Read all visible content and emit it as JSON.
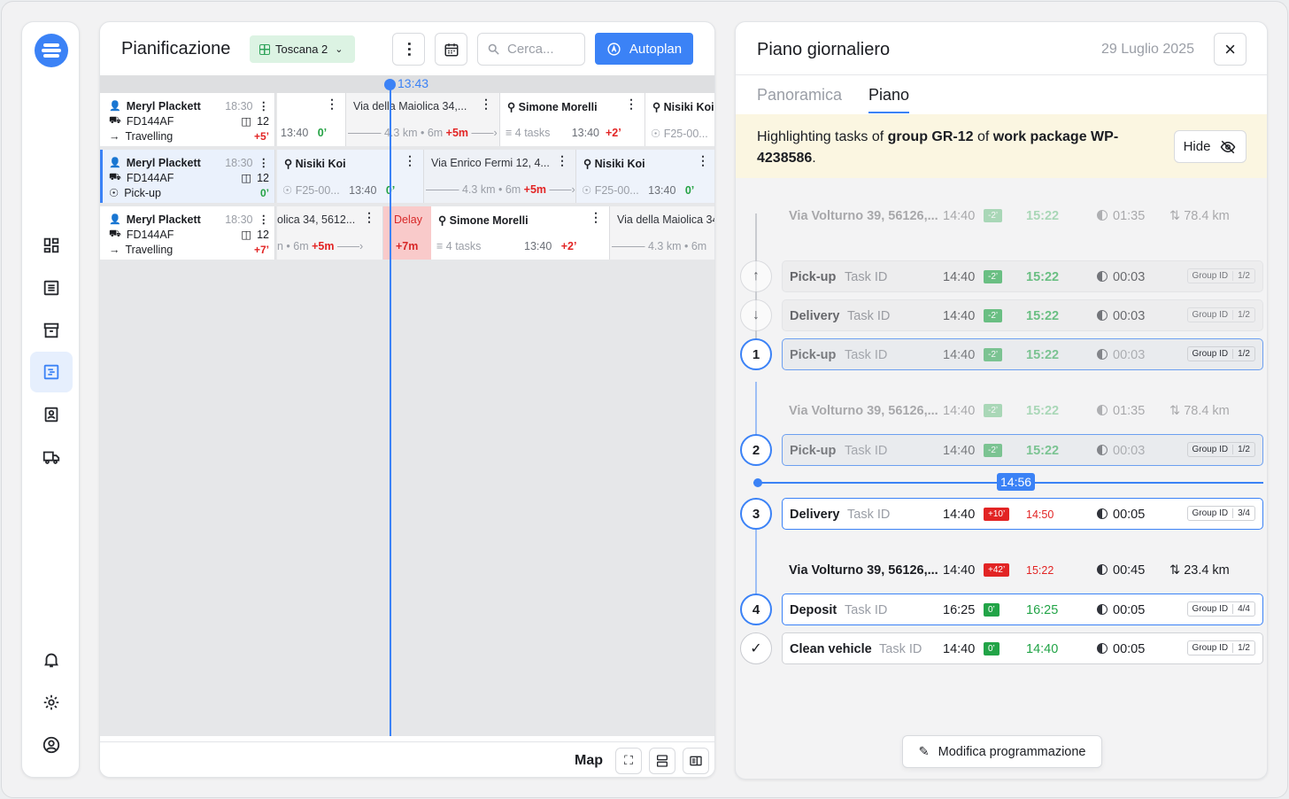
{
  "planning": {
    "title": "Pianificazione",
    "region": "Toscana 2",
    "search_placeholder": "Cerca...",
    "autoplan_label": "Autoplan",
    "now_time": "13:43",
    "map_label": "Map",
    "rows": [
      {
        "driver": "Meryl Plackett",
        "time": "18:30",
        "plate": "FD144AF",
        "count": "12",
        "status": "Travelling",
        "delta": "+5’"
      },
      {
        "driver": "Meryl Plackett",
        "time": "18:30",
        "plate": "FD144AF",
        "count": "12",
        "status": "Pick-up",
        "delta": "0’"
      },
      {
        "driver": "Meryl Plackett",
        "time": "18:30",
        "plate": "FD144AF",
        "count": "12",
        "status": "Travelling",
        "delta": "+7’"
      }
    ],
    "r0": {
      "a_time": "13:40",
      "a_delta": "0’",
      "b_addr": "Via della Maiolica 34,...",
      "b_info": "4.3 km • 6m",
      "b_plus": "+5m",
      "c_name": "Simone Morelli",
      "c_tasks": "4 tasks",
      "c_time": "13:40",
      "c_delta": "+2’",
      "d_name": "Nisiki Koi",
      "d_code": "F25-00..."
    },
    "r1": {
      "a_name": "Nisiki Koi",
      "a_code": "F25-00...",
      "a_time": "13:40",
      "a_delta": "0’",
      "b_addr": "Via Enrico Fermi 12, 4...",
      "b_info": "4.3 km • 6m",
      "b_plus": "+5m",
      "c_name": "Nisiki Koi",
      "c_code": "F25-00...",
      "c_time": "13:40",
      "c_delta": "0’"
    },
    "r2": {
      "a_addr": "olica 34, 5612...",
      "a_info": "n • 6m",
      "a_plus": "+5m",
      "delay_label": "Delay",
      "delay_value": "+7m",
      "b_name": "Simone Morelli",
      "b_tasks": "4 tasks",
      "b_time": "13:40",
      "b_delta": "+2’",
      "c_addr": "Via della Maiolica 34",
      "c_info": "4.3 km • 6m"
    }
  },
  "dayplan": {
    "title": "Piano giornaliero",
    "date": "29 Luglio 2025",
    "tabs": [
      "Panoramica",
      "Piano"
    ],
    "banner": {
      "pre": "Highlighting tasks of ",
      "group": "group GR-12",
      "mid": " of ",
      "wp": "work package WP-4238586",
      "end": "."
    },
    "hide_label": "Hide",
    "now_time": "14:56",
    "edit_label": "Modifica programmazione",
    "stops": [
      {
        "addr": "Via Volturno 39, 56126,...",
        "time": "14:40",
        "badge": "-2’",
        "eta": "15:22",
        "dur": "01:35",
        "dist": "78.4 km"
      },
      {
        "addr": "Via Volturno 39, 56126,...",
        "time": "14:40",
        "badge": "-2’",
        "eta": "15:22",
        "dur": "01:35",
        "dist": "78.4 km"
      },
      {
        "addr": "Via Volturno 39, 56126,...",
        "time": "14:40",
        "badge": "+42’",
        "eta": "15:22",
        "dur": "00:45",
        "dist": "23.4 km"
      }
    ],
    "tasks": [
      {
        "type": "Pick-up",
        "id": "Task ID",
        "time": "14:40",
        "badge": "-2’",
        "eta": "15:22",
        "dur": "00:03",
        "group": "Group ID",
        "frac": "1/2"
      },
      {
        "type": "Delivery",
        "id": "Task ID",
        "time": "14:40",
        "badge": "-2’",
        "eta": "15:22",
        "dur": "00:03",
        "group": "Group ID",
        "frac": "1/2"
      },
      {
        "num": "1",
        "type": "Pick-up",
        "id": "Task ID",
        "time": "14:40",
        "badge": "-2’",
        "eta": "15:22",
        "dur": "00:03",
        "group": "Group ID",
        "frac": "1/2"
      },
      {
        "num": "2",
        "type": "Pick-up",
        "id": "Task ID",
        "time": "14:40",
        "badge": "-2’",
        "eta": "15:22",
        "dur": "00:03",
        "group": "Group ID",
        "frac": "1/2"
      },
      {
        "num": "3",
        "type": "Delivery",
        "id": "Task ID",
        "time": "14:40",
        "badge": "+10’",
        "eta": "14:50",
        "dur": "00:05",
        "group": "Group ID",
        "frac": "3/4"
      },
      {
        "num": "4",
        "type": "Deposit",
        "id": "Task ID",
        "time": "16:25",
        "badge": "0’",
        "eta": "16:25",
        "dur": "00:05",
        "group": "Group ID",
        "frac": "4/4"
      },
      {
        "type": "Clean vehicle",
        "id": "Task ID",
        "time": "14:40",
        "badge": "0’",
        "eta": "14:40",
        "dur": "00:05",
        "group": "Group ID",
        "frac": "1/2"
      }
    ]
  }
}
